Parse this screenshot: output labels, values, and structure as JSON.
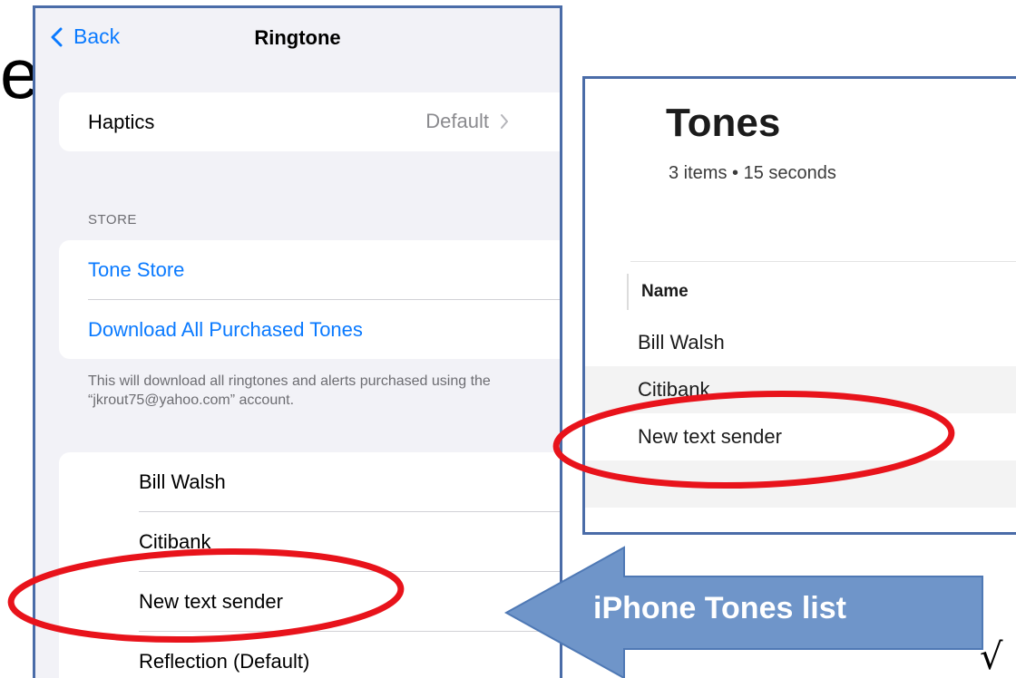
{
  "slide": {
    "title_fragment": "e",
    "checkmark": "√"
  },
  "ringtone_screen": {
    "nav": {
      "back_label": "Back",
      "title": "Ringtone"
    },
    "haptics": {
      "label": "Haptics",
      "value": "Default"
    },
    "store": {
      "section_header": "STORE",
      "tone_store_label": "Tone Store",
      "download_all_label": "Download All Purchased Tones",
      "footer": "This will download all ringtones and alerts purchased using the “jkrout75@yahoo.com” account."
    },
    "tones": [
      {
        "name": "Bill Walsh"
      },
      {
        "name": "Citibank"
      },
      {
        "name": "New text sender"
      },
      {
        "name": "Reflection (Default)"
      }
    ]
  },
  "itunes_tones": {
    "title": "Tones",
    "subtitle": "3 items • 15 seconds",
    "column_header": "Name",
    "rows": [
      {
        "name": "Bill Walsh"
      },
      {
        "name": "Citibank"
      },
      {
        "name": "New text sender"
      },
      {
        "name": ""
      }
    ]
  },
  "callout": {
    "label": "iPhone Tones list"
  },
  "colors": {
    "ios_blue": "#0a7aff",
    "highlight_red": "#e8131b",
    "callout_fill": "#6f95c9",
    "panel_border": "#4a6ca8"
  }
}
